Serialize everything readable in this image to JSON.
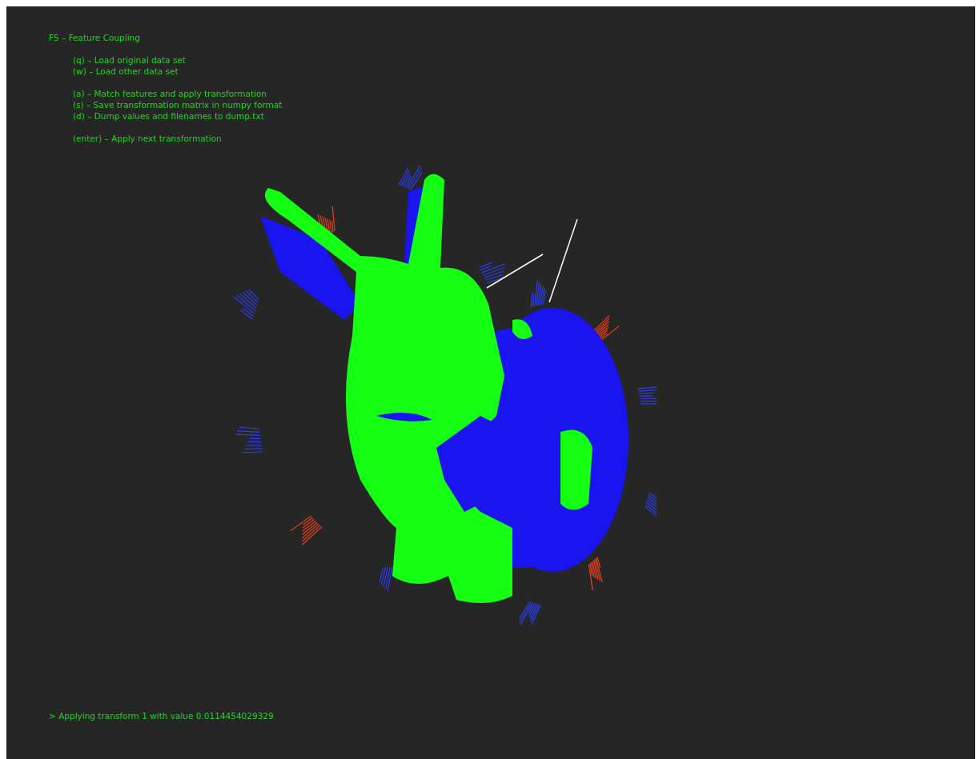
{
  "title": "F5 – Feature Coupling",
  "sections": [
    [
      "(q) – Load original data set",
      "(w) – Load other data set"
    ],
    [
      "(a) – Match features and apply transformation",
      "(s) – Save transformation matrix in numpy format",
      "(d) – Dump values and filenames to dump.txt"
    ],
    [
      "(enter) – Apply next transformation"
    ]
  ],
  "status": "> Applying transform 1 with value 0.0114454029329"
}
